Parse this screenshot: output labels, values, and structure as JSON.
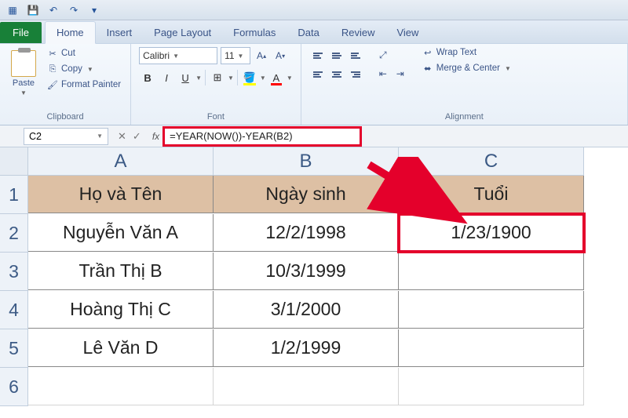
{
  "qat": {
    "save": "save-icon",
    "undo": "undo-icon",
    "redo": "redo-icon",
    "print": "print-icon"
  },
  "tabs": {
    "file": "File",
    "home": "Home",
    "insert": "Insert",
    "pagelayout": "Page Layout",
    "formulas": "Formulas",
    "data": "Data",
    "review": "Review",
    "view": "View"
  },
  "clipboard": {
    "paste": "Paste",
    "cut": "Cut",
    "copy": "Copy",
    "format_painter": "Format Painter",
    "group": "Clipboard"
  },
  "font": {
    "name": "Calibri",
    "size": "11",
    "group": "Font"
  },
  "alignment": {
    "wrap": "Wrap Text",
    "merge": "Merge & Center",
    "group": "Alignment"
  },
  "namebox": "C2",
  "formula": "=YEAR(NOW())-YEAR(B2)",
  "columns": [
    "A",
    "B",
    "C"
  ],
  "rows": [
    "1",
    "2",
    "3",
    "4",
    "5",
    "6"
  ],
  "table": {
    "headers": {
      "a": "Họ và Tên",
      "b": "Ngày sinh",
      "c": "Tuổi"
    },
    "r2": {
      "a": "Nguyễn Văn A",
      "b": "12/2/1998",
      "c": "1/23/1900"
    },
    "r3": {
      "a": "Trần Thị B",
      "b": "10/3/1999",
      "c": ""
    },
    "r4": {
      "a": "Hoàng Thị C",
      "b": "3/1/2000",
      "c": ""
    },
    "r5": {
      "a": "Lê Văn D",
      "b": "1/2/1999",
      "c": ""
    }
  }
}
